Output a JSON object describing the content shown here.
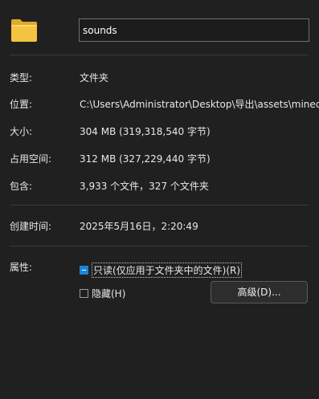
{
  "header": {
    "folder_icon": "folder-icon",
    "name_value": "sounds"
  },
  "properties": {
    "type_label": "类型:",
    "type_value": "文件夹",
    "location_label": "位置:",
    "location_value": "C:\\Users\\Administrator\\Desktop\\导出\\assets\\minecraft",
    "size_label": "大小:",
    "size_value": "304 MB (319,318,540 字节)",
    "size_on_disk_label": "占用空间:",
    "size_on_disk_value": "312 MB (327,229,440 字节)",
    "contains_label": "包含:",
    "contains_value": "3,933 个文件，327 个文件夹",
    "created_label": "创建时间:",
    "created_value": "2025年5月16日，2:20:49"
  },
  "attributes": {
    "label": "属性:",
    "readonly_label": "只读(仅应用于文件夹中的文件)(R)",
    "readonly_state": "indeterminate",
    "hidden_label": "隐藏(H)",
    "hidden_checked": false,
    "advanced_button": "高级(D)..."
  },
  "colors": {
    "background": "#202020",
    "accent": "#1a86d8"
  }
}
